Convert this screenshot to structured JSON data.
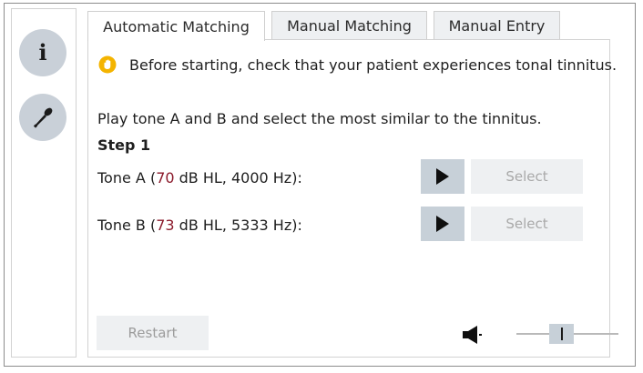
{
  "tabs": [
    {
      "label": "Automatic Matching",
      "active": true
    },
    {
      "label": "Manual Matching",
      "active": false
    },
    {
      "label": "Manual Entry",
      "active": false
    }
  ],
  "sidebar": {
    "info_label": "i"
  },
  "notice": {
    "icon": "hand-icon",
    "text": "Before starting, check that your patient experiences tonal tinnitus."
  },
  "instruction": "Play tone A and B and select the most similar to the tinnitus.",
  "step_label": "Step 1",
  "tones": [
    {
      "prefix": "Tone A (",
      "level": "70",
      "suffix": " dB HL, 4000 Hz):",
      "select_label": "Select"
    },
    {
      "prefix": "Tone B (",
      "level": "73",
      "suffix": " dB HL, 5333 Hz):",
      "select_label": "Select"
    }
  ],
  "restart_label": "Restart",
  "volume": {
    "icon": "speaker-icon",
    "level": 0.4
  },
  "colors": {
    "level_value": "#8b1a2b",
    "button_bg": "#c7d0d8",
    "disabled_bg": "#eef0f2"
  }
}
